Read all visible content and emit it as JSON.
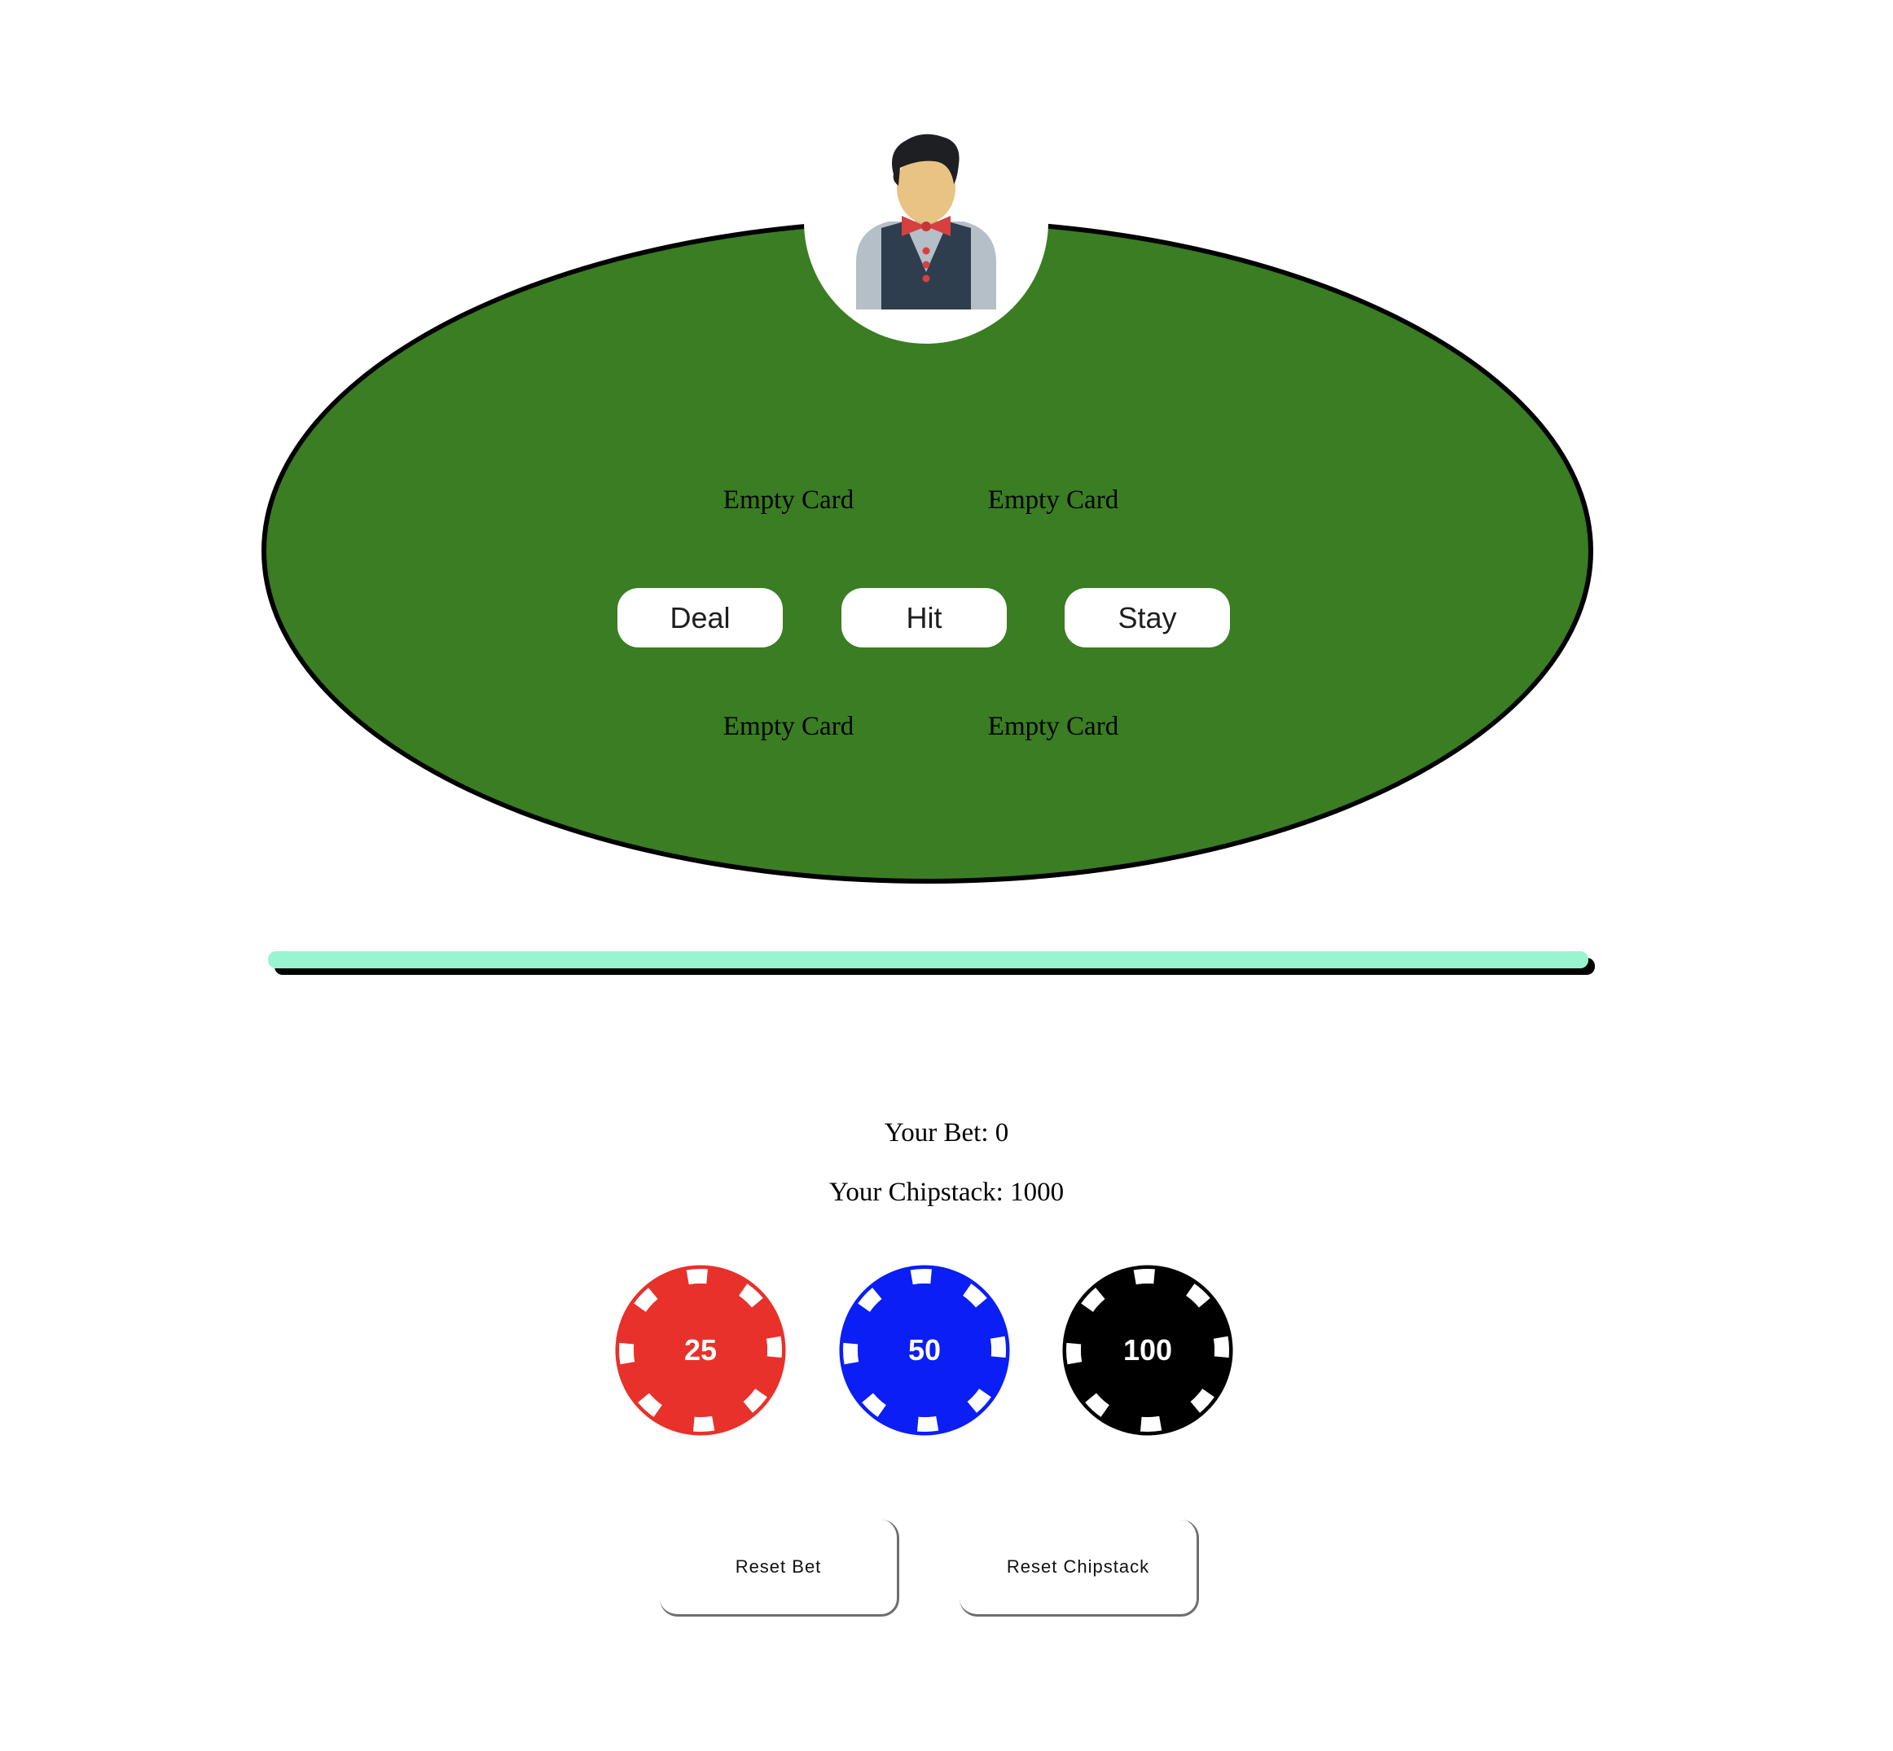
{
  "table": {
    "felt_color": "#3a7d23",
    "dealer_icon": "dealer-avatar-icon",
    "dealer_cards": [
      "Empty Card",
      "Empty Card"
    ],
    "player_cards": [
      "Empty Card",
      "Empty Card"
    ],
    "actions": {
      "deal_label": "Deal",
      "hit_label": "Hit",
      "stay_label": "Stay"
    }
  },
  "divider_color": "#99f5cf",
  "betting": {
    "bet_text": "Your Bet: 0",
    "chipstack_text": "Your Chipstack: 1000"
  },
  "chips": [
    {
      "label": "25",
      "color": "#e8312a"
    },
    {
      "label": "50",
      "color": "#0a1ef5"
    },
    {
      "label": "100",
      "color": "#000000"
    }
  ],
  "controls": {
    "reset_bet_label": "Reset Bet",
    "reset_chipstack_label": "Reset Chipstack"
  }
}
